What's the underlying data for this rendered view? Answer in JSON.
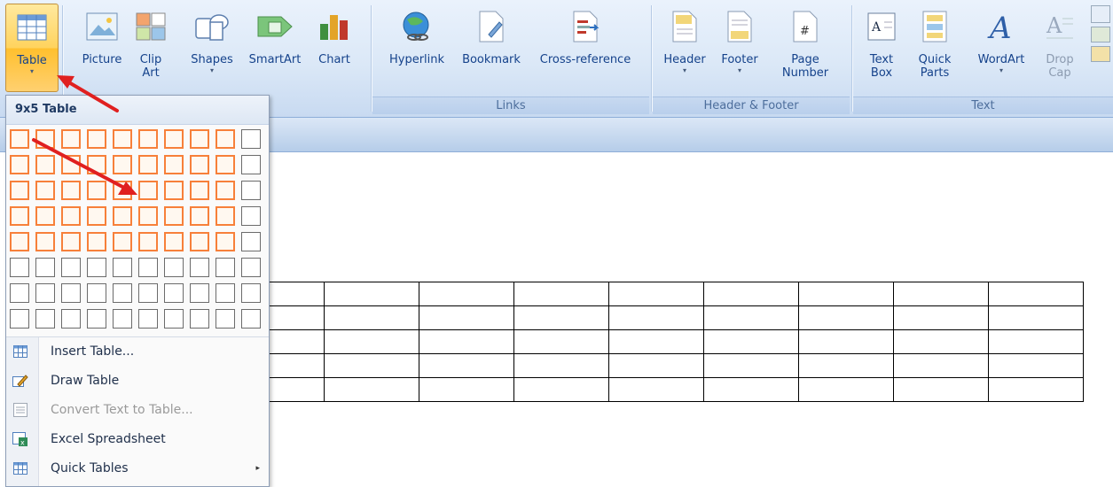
{
  "ribbon": {
    "table_label": "Table",
    "picture_label": "Picture",
    "clipart_label_1": "Clip",
    "clipart_label_2": "Art",
    "shapes_label": "Shapes",
    "smartart_label": "SmartArt",
    "chart_label": "Chart",
    "hyperlink_label": "Hyperlink",
    "bookmark_label": "Bookmark",
    "crossref_label": "Cross-reference",
    "header_label": "Header",
    "footer_label": "Footer",
    "pagenumber_label_1": "Page",
    "pagenumber_label_2": "Number",
    "textbox_label_1": "Text",
    "textbox_label_2": "Box",
    "quickparts_label_1": "Quick",
    "quickparts_label_2": "Parts",
    "wordart_label": "WordArt",
    "dropcap_label_1": "Drop",
    "dropcap_label_2": "Cap",
    "group_links": "Links",
    "group_header_footer": "Header & Footer",
    "group_text": "Text",
    "dropdown_arrow": "▾"
  },
  "dropdown": {
    "title": "9x5 Table",
    "grid_cols": 10,
    "grid_rows": 8,
    "selected_cols": 9,
    "selected_rows": 5,
    "items": [
      {
        "label": "Insert Table...",
        "enabled": true,
        "submenu": false
      },
      {
        "label": "Draw Table",
        "enabled": true,
        "submenu": false
      },
      {
        "label": "Convert Text to Table...",
        "enabled": false,
        "submenu": false
      },
      {
        "label": "Excel Spreadsheet",
        "enabled": true,
        "submenu": false
      },
      {
        "label": "Quick Tables",
        "enabled": true,
        "submenu": true
      }
    ],
    "submenu_glyph": "▸"
  },
  "document_table": {
    "cols": 9,
    "rows": 5
  },
  "colors": {
    "selection": "#f7803a",
    "annotation_arrow": "#e02020"
  }
}
